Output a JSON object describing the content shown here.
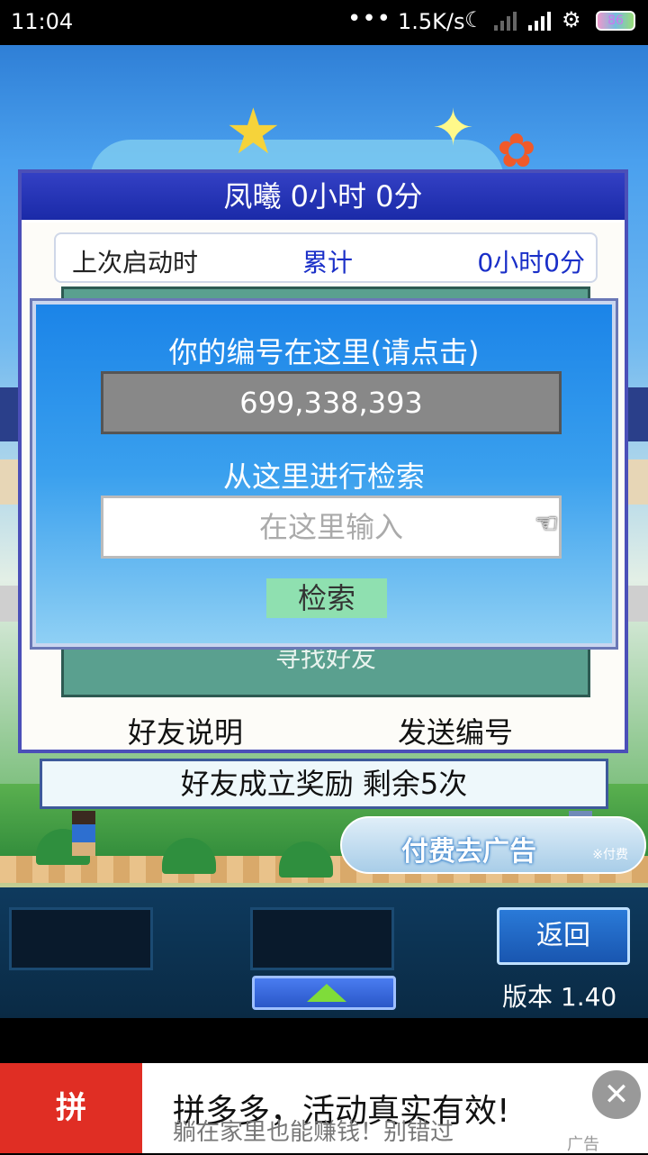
{
  "status_bar": {
    "time": "11:04",
    "dots": "•••",
    "network_speed": "1.5K/s",
    "moon_icon": "☾",
    "wifi_icon": "⚙",
    "battery": "86"
  },
  "stats_panel": {
    "title": "凤曦  0小时 0分",
    "last_launch_label": "上次启动时",
    "cumulative_label": "累计",
    "cumulative_value": "0小时0分",
    "hidden_button_text": "寻找好友",
    "friend_help": "好友说明",
    "send_code": "发送编号"
  },
  "reward_bar": {
    "text": "好友成立奖励  剩余5次"
  },
  "remove_ad": {
    "label": "付费去广告",
    "tag": "※付费"
  },
  "bottom_bar": {
    "back_label": "返回",
    "version": "版本 1.40"
  },
  "dialog": {
    "title": "你的编号在这里(请点击)",
    "code": "699,338,393",
    "search_label": "从这里进行检索",
    "input_placeholder": "在这里输入",
    "search_button": "检索",
    "hand_icon": "☜"
  },
  "ad_banner": {
    "logo_text": "拼",
    "headline": "拼多多，活动真实有效!",
    "subline": "躺在家里也能赚钱！别错过",
    "close_icon": "✕",
    "ad_tag": "广告"
  }
}
